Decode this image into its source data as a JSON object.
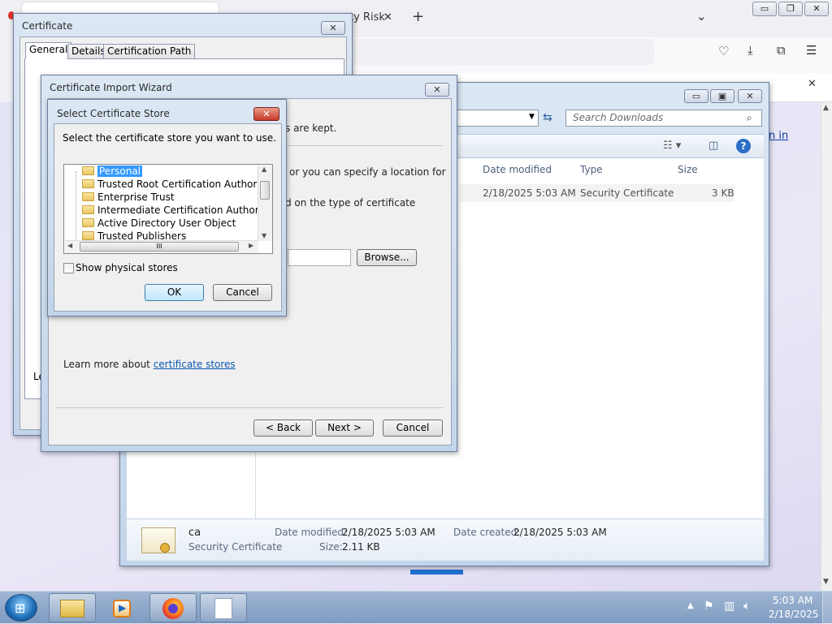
{
  "browser": {
    "tab_label_partial": "ty Risk",
    "sign_in_partial": "n in",
    "icons": [
      "close-tab-icon",
      "new-tab-icon",
      "tab-list-icon",
      "pocket-icon",
      "downloads-icon",
      "extensions-icon",
      "menu-icon",
      "notification-close-icon",
      "minimize-icon",
      "restore-icon",
      "close-icon"
    ]
  },
  "explorer": {
    "search_placeholder": "Search Downloads",
    "columns": {
      "date": "Date modified",
      "type": "Type",
      "size": "Size"
    },
    "file_row": {
      "date": "2/18/2025 5:03 AM",
      "type": "Security Certificate",
      "size": "3 KB"
    },
    "details": {
      "name": "ca",
      "type": "Security Certificate",
      "date_modified_label": "Date modified:",
      "date_modified": "2/18/2025 5:03 AM",
      "date_created_label": "Date created:",
      "date_created": "2/18/2025 5:03 AM",
      "size_label": "Size:",
      "size": "2.11 KB"
    }
  },
  "certificate": {
    "title": "Certificate",
    "tabs": [
      "General",
      "Details",
      "Certification Path"
    ],
    "partial_text": "Le"
  },
  "wizard": {
    "title": "Certificate Import Wizard",
    "text_kept": "s are kept.",
    "text_specify": "or you can specify a location for",
    "text_type": "d on the type of certificate",
    "browse": "Browse...",
    "learn_more": "Learn more about ",
    "learn_link": "certificate stores",
    "back": "< Back",
    "next": "Next >",
    "cancel": "Cancel"
  },
  "store_dialog": {
    "title": "Select Certificate Store",
    "prompt": "Select the certificate store you want to use.",
    "stores": [
      "Personal",
      "Trusted Root Certification Authorities",
      "Enterprise Trust",
      "Intermediate Certification Authorities",
      "Active Directory User Object",
      "Trusted Publishers"
    ],
    "selected_store": "Personal",
    "show_physical": "Show physical stores",
    "ok": "OK",
    "cancel": "Cancel",
    "hscroll_grip": "III"
  },
  "taskbar": {
    "time": "5:03 AM",
    "date": "2/18/2025"
  }
}
